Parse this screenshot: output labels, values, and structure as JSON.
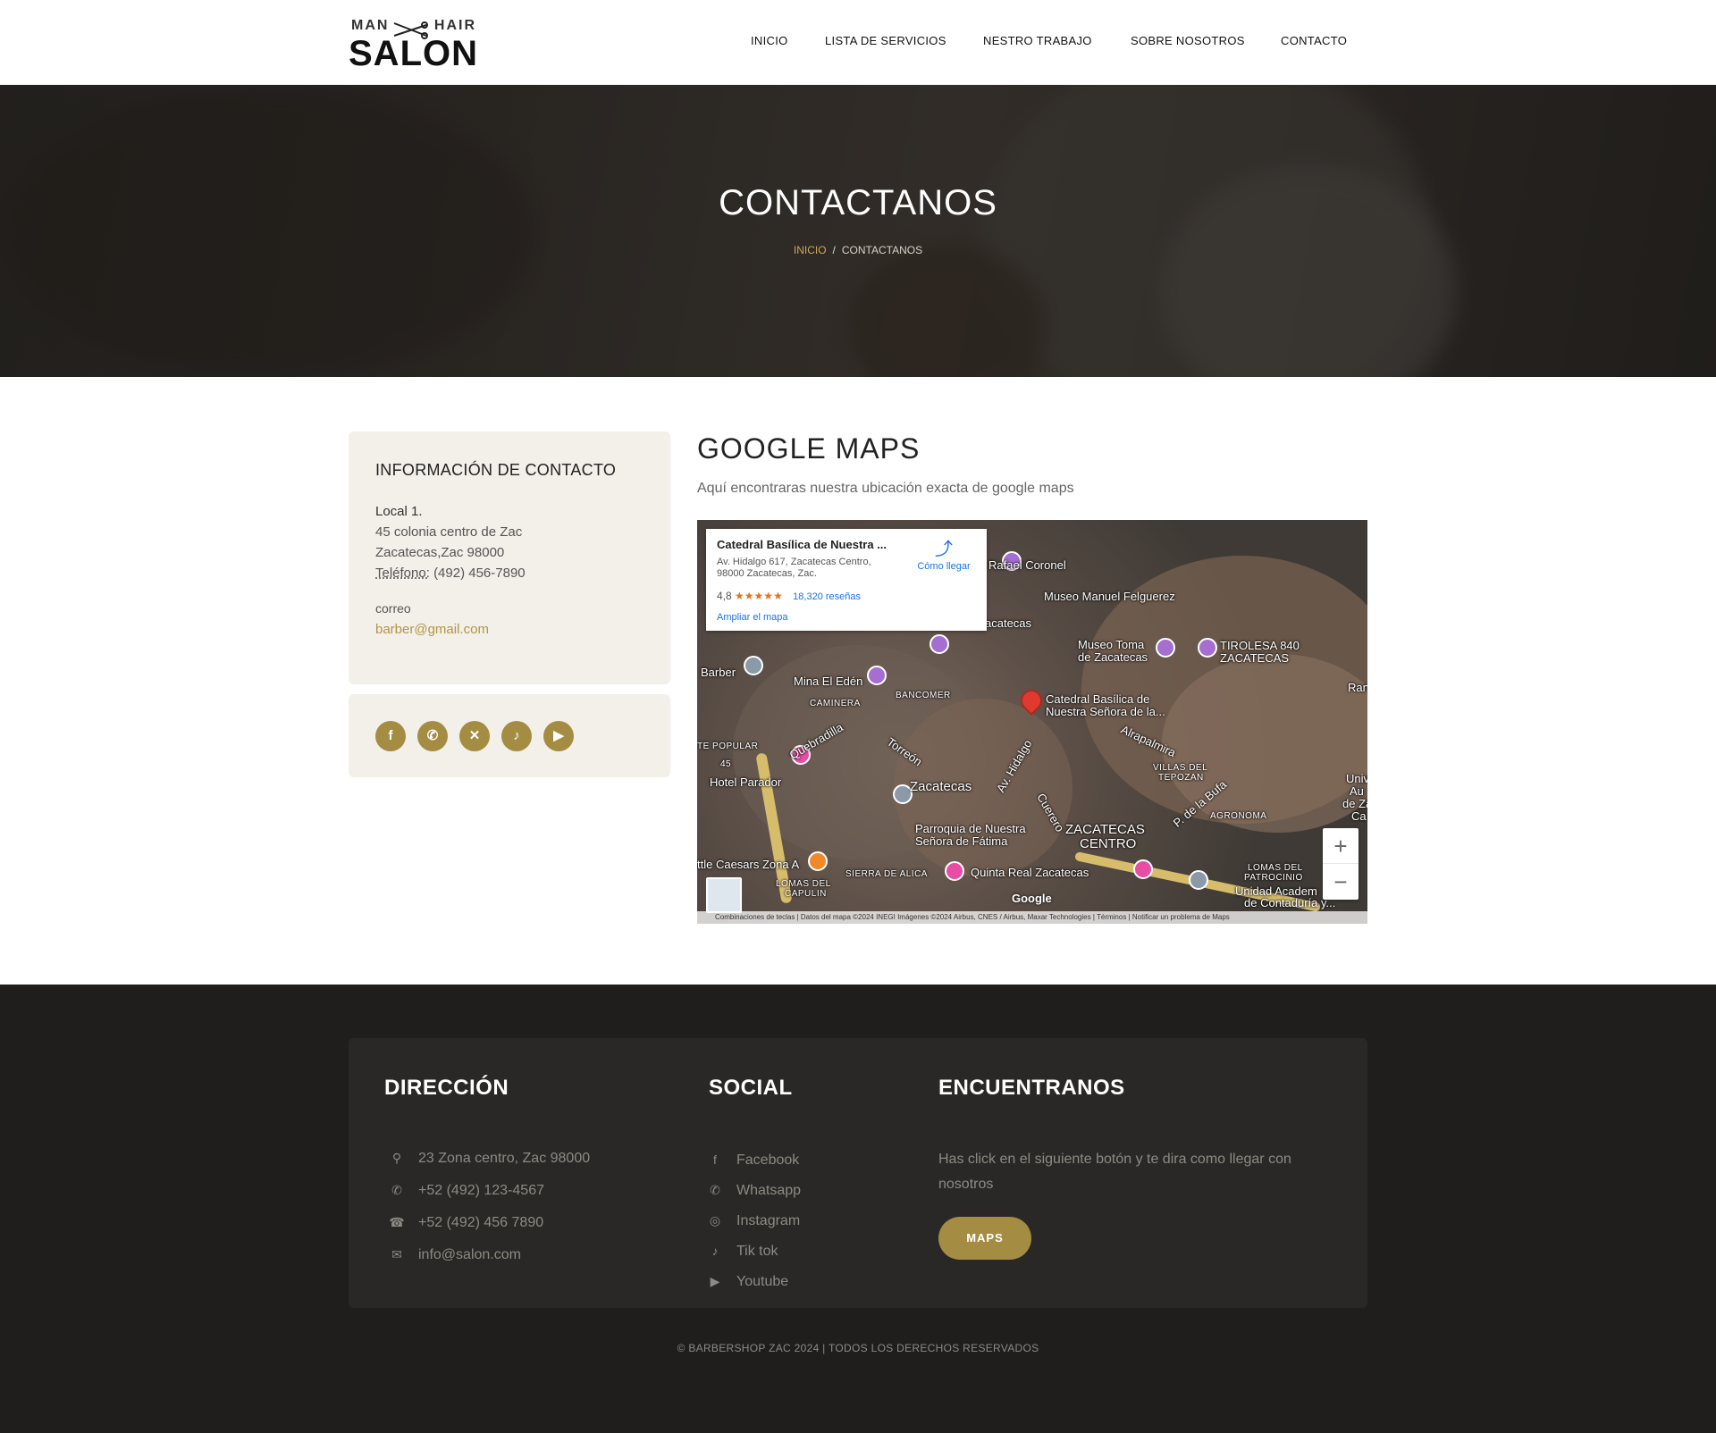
{
  "header": {
    "logo_top_left": "MAN",
    "logo_top_right": "HAIR",
    "logo_main": "SALON",
    "nav": [
      "INICIO",
      "LISTA DE SERVICIOS",
      "NESTRO TRABAJO",
      "SOBRE NOSOTROS",
      "CONTACTO"
    ]
  },
  "hero": {
    "title": "CONTACTANOS",
    "breadcrumb_home": "INICIO",
    "breadcrumb_sep": "/",
    "breadcrumb_current": "CONTACTANOS"
  },
  "contact": {
    "heading": "INFORMACIÓN DE CONTACTO",
    "local": "Local 1.",
    "address1": "45 colonia centro de Zac",
    "address2": "Zacatecas,Zac 98000",
    "phone_label": "Teléfono:",
    "phone": "(492) 456-7890",
    "email_label": "correo",
    "email": "barber@gmail.com",
    "accent": "#a58c43",
    "social_icons": [
      "facebook-icon",
      "whatsapp-icon",
      "x-icon",
      "tiktok-icon",
      "youtube-icon"
    ]
  },
  "gmaps": {
    "title": "GOOGLE MAPS",
    "subtitle": "Aquí encontraras nuestra ubicación exacta de google maps",
    "info": {
      "place": "Catedral Basílica de Nuestra ...",
      "address_line1": "Av. Hidalgo 617, Zacatecas Centro,",
      "address_line2": "98000 Zacatecas, Zac.",
      "rating": "4,8",
      "stars": "★★★★★",
      "reviews": "18,320 reseñas",
      "enlarge": "Ampliar el mapa",
      "directions": "Cómo llegar"
    },
    "labels": {
      "rafael": "Rafael Coronel",
      "museo_mf": "Museo Manuel Felguerez",
      "zacatecas_top": "acatecas",
      "toma1": "Museo Toma",
      "toma2": "de Zacatecas",
      "tirolesa1": "TIROLESA 840",
      "tirolesa2": "ZACATECAS",
      "barber": "Barber",
      "mina": "Mina El Edén",
      "bancomer": "BANCOMER",
      "caminera": "CAMINERA",
      "catedral1": "Catedral Basílica de",
      "catedral2": "Nuestra Señora de la...",
      "popular": "TE POPULAR",
      "quebradilla": "Quebradilla",
      "torreon": "Torreón",
      "hidalgo": "Av. Hidalgo",
      "alrapalmira": "Alrapalmira",
      "hotel": "Hotel Parador",
      "zacatecas": "Zacatecas",
      "villas1": "VILLAS DEL",
      "villas2": "TEPOZAN",
      "labufa": "P. de la Bufa",
      "agronomia": "AGRONOMA",
      "parroquia1": "Parroquia de Nuestra",
      "parroquia2": "Señora de Fátima",
      "centro1": "ZACATECAS",
      "centro2": "CENTRO",
      "cuerero": "Cuerero",
      "caesars": "ttle Caesars Zona A",
      "sierra": "SIERRA DE ALICA",
      "quinta": "Quinta Real Zacatecas",
      "lomas_cap1": "LOMAS DEL",
      "lomas_cap2": "CAPULIN",
      "lomas_pat1": "LOMAS DEL",
      "lomas_pat2": "PATROCINIO",
      "unidad1": "Unidad Academ",
      "unidad2": "de Contaduría y...",
      "uni1": "Univ",
      "uni2": "Au",
      "uni3": "de Za",
      "uni4": "Ca",
      "ran": "Ran",
      "route45": "45",
      "google": "Google"
    },
    "attribution": "Combinaciones de teclas  |  Datos del mapa ©2024 INEGI Imágenes ©2024 Airbus, CNES / Airbus, Maxar Technologies  |  Términos  |  Notificar un problema de Maps",
    "zoom_in": "+",
    "zoom_out": "−"
  },
  "footer": {
    "direccion_title": "DIRECCIÓN",
    "social_title": "SOCIAL",
    "encuentranos_title": "ENCUENTRANOS",
    "address": "23 Zona centro, Zac 98000",
    "phone1": "+52 (492) 123-4567",
    "phone2": "+52 (492) 456 7890",
    "email": "info@salon.com",
    "social": [
      "Facebook",
      "Whatsapp",
      "Instagram",
      "Tik tok",
      "Youtube"
    ],
    "description": "Has click en el siguiente botón y te dira como llegar con nosotros",
    "maps_button": "MAPS",
    "copyright": "© BARBERSHOP ZAC 2024 | TODOS LOS DERECHOS RESERVADOS"
  }
}
